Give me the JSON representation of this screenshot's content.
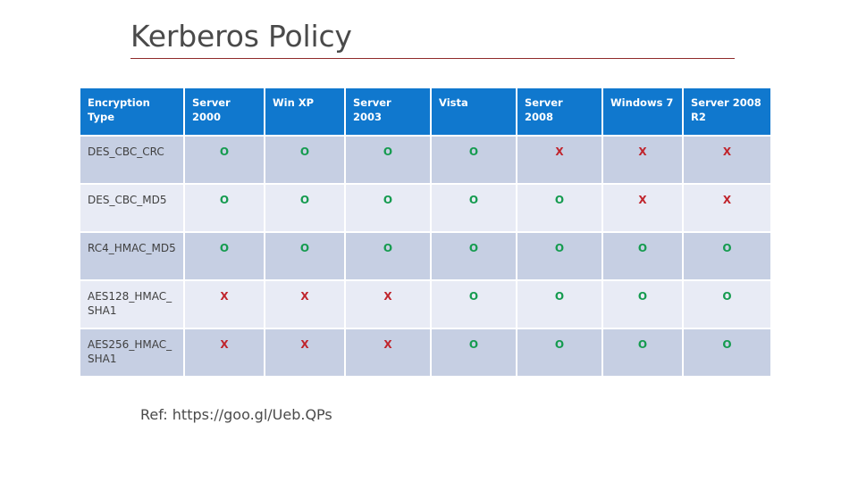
{
  "slide": {
    "title": "Kerberos Policy",
    "title_rule_color": "#8f2b2b"
  },
  "table": {
    "header_bg": "#1078ce",
    "row_dark_bg": "#c6cfe3",
    "row_light_bg": "#e8ebf5",
    "mark_yes_color": "#159b4f",
    "mark_no_color": "#c0242c",
    "columns": [
      "Encryption Type",
      "Server 2000",
      "Win XP",
      "Server 2003",
      "Vista",
      "Server 2008",
      "Windows 7",
      "Server 2008 R2"
    ],
    "rows": [
      {
        "label": "DES_CBC_CRC",
        "cells": [
          "O",
          "O",
          "O",
          "O",
          "X",
          "X",
          "X"
        ]
      },
      {
        "label": "DES_CBC_MD5",
        "cells": [
          "O",
          "O",
          "O",
          "O",
          "O",
          "X",
          "X"
        ]
      },
      {
        "label": "RC4_HMAC_MD5",
        "cells": [
          "O",
          "O",
          "O",
          "O",
          "O",
          "O",
          "O"
        ]
      },
      {
        "label": "AES128_HMAC_SHA1",
        "cells": [
          "X",
          "X",
          "X",
          "O",
          "O",
          "O",
          "O"
        ]
      },
      {
        "label": "AES256_HMAC_SHA1",
        "cells": [
          "X",
          "X",
          "X",
          "O",
          "O",
          "O",
          "O"
        ]
      }
    ]
  },
  "footer": {
    "reference": "Ref: https://goo.gl/Ueb.QPs"
  }
}
